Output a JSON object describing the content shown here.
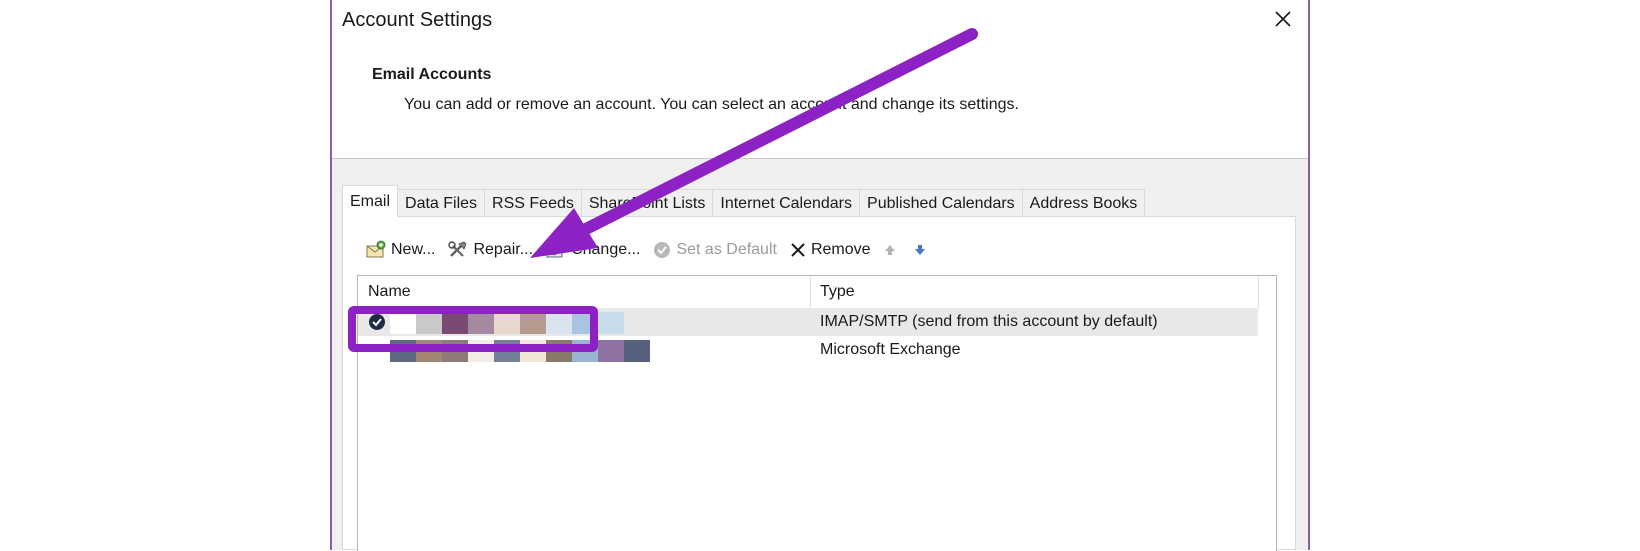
{
  "window": {
    "title": "Account Settings",
    "close_icon": "close-icon"
  },
  "header": {
    "heading": "Email Accounts",
    "description": "You can add or remove an account. You can select an account and change its settings."
  },
  "tabs": [
    {
      "label": "Email",
      "active": true
    },
    {
      "label": "Data Files",
      "active": false
    },
    {
      "label": "RSS Feeds",
      "active": false
    },
    {
      "label": "SharePoint Lists",
      "active": false
    },
    {
      "label": "Internet Calendars",
      "active": false
    },
    {
      "label": "Published Calendars",
      "active": false
    },
    {
      "label": "Address Books",
      "active": false
    }
  ],
  "toolbar": {
    "new_label": "New...",
    "repair_label": "Repair...",
    "change_label": "Change...",
    "set_default_label": "Set as Default",
    "remove_label": "Remove"
  },
  "list": {
    "columns": {
      "name": "Name",
      "type": "Type"
    },
    "rows": [
      {
        "type": "IMAP/SMTP (send from this account by default)",
        "default": true,
        "blur_colors": [
          "#ffffff",
          "#c9c9c9",
          "#7a4a73",
          "#a48aa0",
          "#e7d8cc",
          "#b59a8f",
          "#d9e4ee",
          "#a9c4e0",
          "#c7dbe8"
        ]
      },
      {
        "type": "Microsoft Exchange",
        "default": false,
        "blur_colors": [
          "#5d6a82",
          "#a38574",
          "#8d7a79",
          "#f2ede4",
          "#738099",
          "#efe6d6",
          "#8a7a6a",
          "#9bb4d4",
          "#8d72a3",
          "#54607d"
        ]
      }
    ]
  },
  "colors": {
    "annotation_purple": "#8d22c4",
    "dialog_border": "#8b5fa8"
  }
}
